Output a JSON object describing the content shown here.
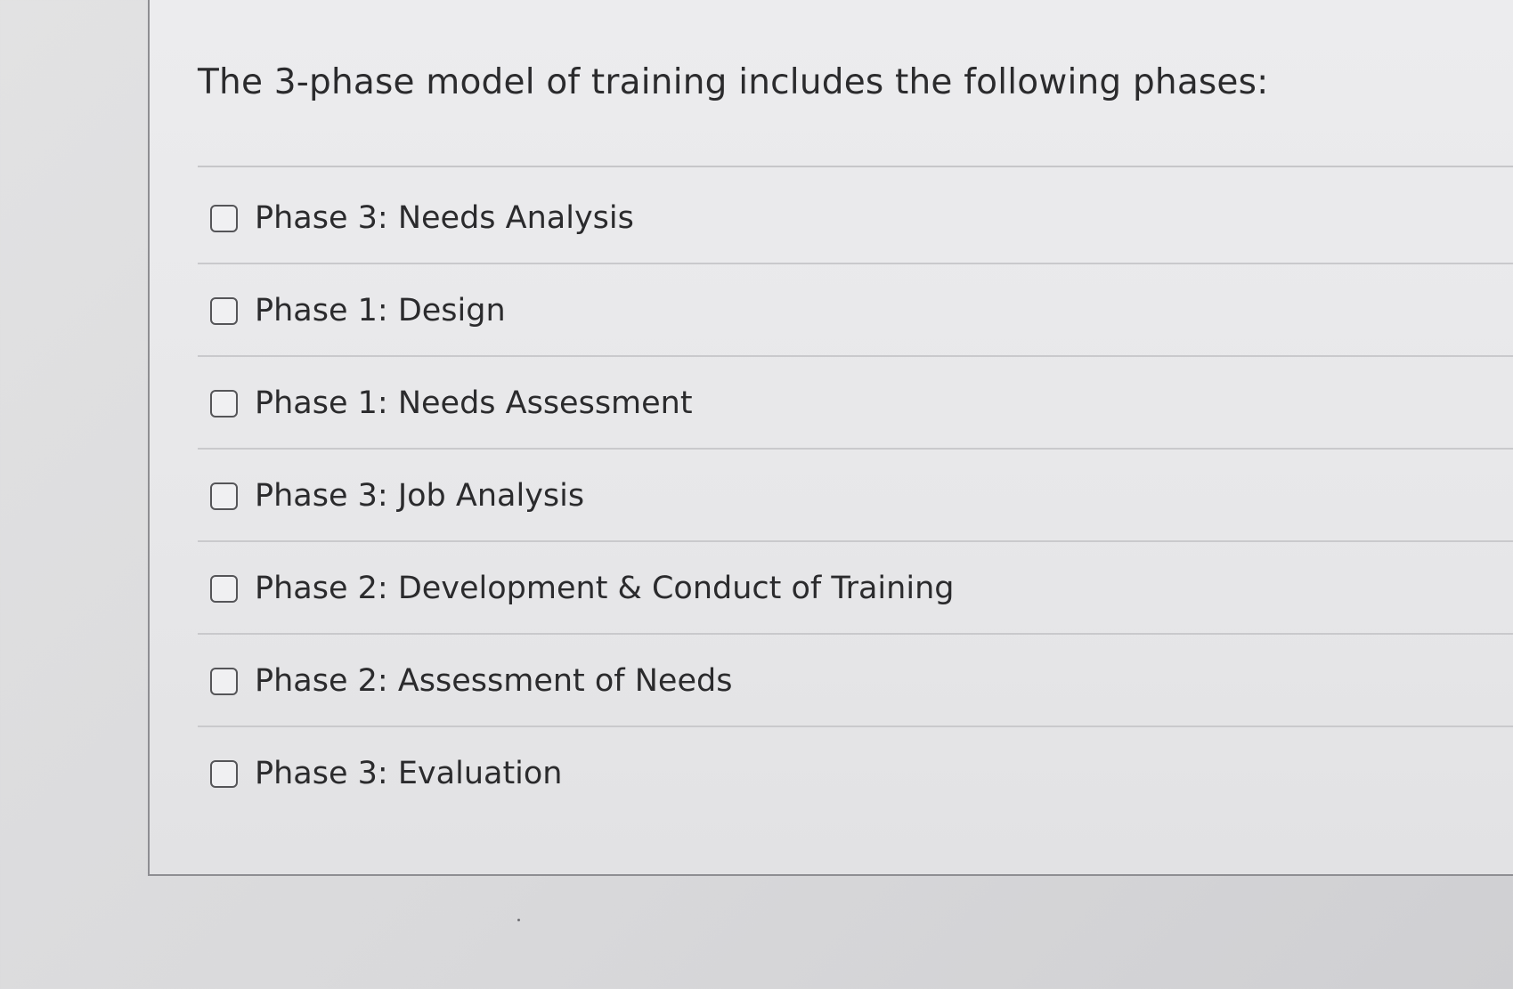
{
  "question": {
    "text": "The 3-phase model of training includes the following phases:"
  },
  "answers": [
    {
      "label": "Phase 3: Needs Analysis",
      "checked": false
    },
    {
      "label": "Phase 1: Design",
      "checked": false
    },
    {
      "label": "Phase 1: Needs Assessment",
      "checked": false
    },
    {
      "label": "Phase 3: Job Analysis",
      "checked": false
    },
    {
      "label": "Phase 2: Development & Conduct of Training",
      "checked": false
    },
    {
      "label": "Phase 2: Assessment of Needs",
      "checked": false
    },
    {
      "label": "Phase 3: Evaluation",
      "checked": false
    }
  ]
}
